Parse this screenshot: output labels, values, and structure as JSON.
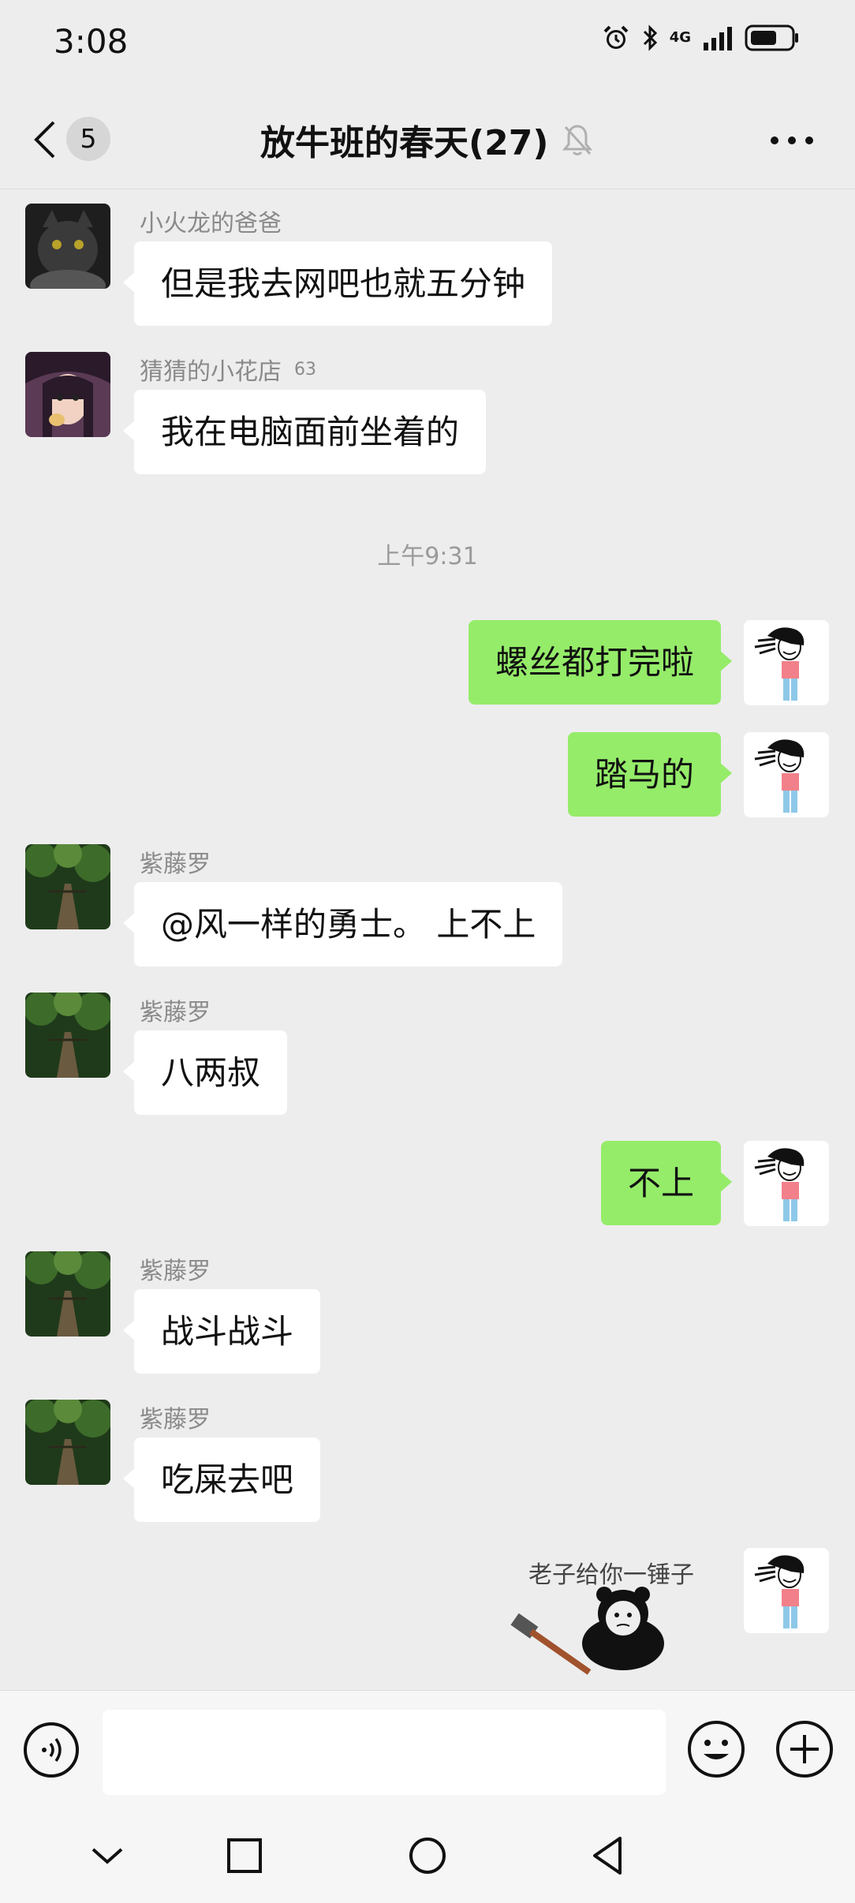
{
  "status_bar": {
    "time": "3:08",
    "network": "4G",
    "alarm_icon": "alarm-icon",
    "bluetooth_icon": "bluetooth-icon",
    "signal_icon": "signal-icon",
    "battery_icon": "battery-icon"
  },
  "header": {
    "back_icon": "chevron-left-icon",
    "unread_count": "5",
    "title": "放牛班的春天(27)",
    "mute_icon": "bell-off-icon",
    "more_icon": "ellipsis-icon"
  },
  "messages": [
    {
      "type": "in",
      "sender": "小火龙的爸爸",
      "text": "但是我去网吧也就五分钟"
    },
    {
      "type": "in",
      "sender": "猜猜的小花店",
      "text": "我在电脑面前坐着的"
    },
    {
      "type": "timestamp",
      "text": "上午9:31"
    },
    {
      "type": "out",
      "text": "螺丝都打完啦"
    },
    {
      "type": "out",
      "text": "踏马的"
    },
    {
      "type": "in",
      "sender": "紫藤罗",
      "text": "@风一样的勇士。 上不上"
    },
    {
      "type": "in",
      "sender": "紫藤罗",
      "text": "八两叔"
    },
    {
      "type": "out",
      "text": "不上"
    },
    {
      "type": "in",
      "sender": "紫藤罗",
      "text": "战斗战斗"
    },
    {
      "type": "in",
      "sender": "紫藤罗",
      "text": "吃屎去吧"
    },
    {
      "type": "sticker",
      "caption": "老子给你一锤子"
    }
  ],
  "input_bar": {
    "voice_icon": "voice-icon",
    "text_value": "",
    "emoji_icon": "emoji-icon",
    "plus_icon": "plus-icon"
  },
  "nav_bar": {
    "down_icon": "chevron-down-icon",
    "recents_icon": "square-icon",
    "home_icon": "circle-icon",
    "back_icon": "triangle-back-icon"
  },
  "colors": {
    "background": "#ededed",
    "incoming_bubble": "#ffffff",
    "outgoing_bubble": "#95ec69"
  }
}
